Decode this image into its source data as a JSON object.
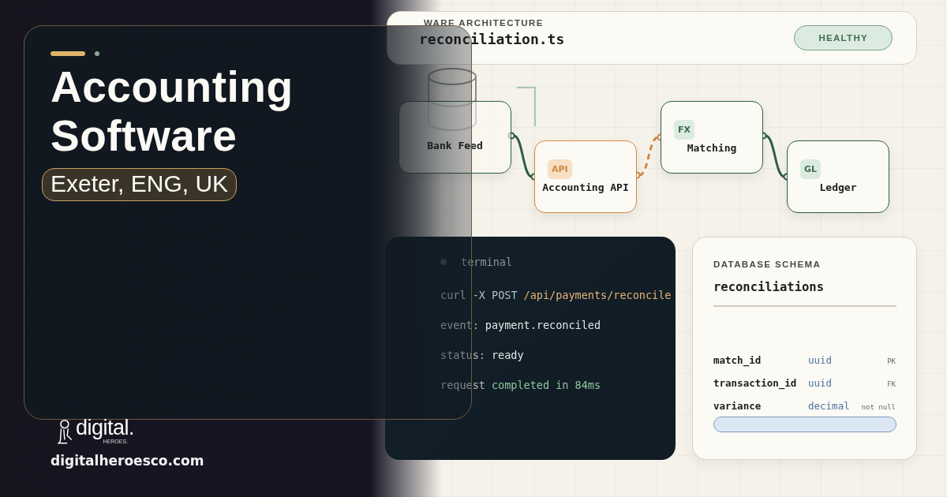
{
  "hero": {
    "title": "Accounting Software",
    "location": "Exeter, ENG, UK"
  },
  "brand": {
    "logo_text": "digital.",
    "logo_subtext": "HEROES.",
    "website": "digitalheroesco.com"
  },
  "architecture": {
    "eyebrow": "WARE ARCHITECTURE",
    "file": "reconciliation.ts",
    "status": "HEALTHY",
    "nodes": [
      {
        "kind": "database",
        "label": "Bank Feed"
      },
      {
        "kind": "accent",
        "badge": "API",
        "label": "Accounting API"
      },
      {
        "kind": "plain",
        "badge": "FX",
        "label": "Matching"
      },
      {
        "kind": "plain",
        "badge": "GL",
        "label": "Ledger"
      }
    ]
  },
  "terminal": {
    "title": "terminal",
    "lines": [
      {
        "kind": "command",
        "prefix": "curl -X POST",
        "text": "/api/payments/reconcile"
      },
      {
        "kind": "output",
        "prefix": "event:",
        "text": "payment.reconciled"
      },
      {
        "kind": "output",
        "prefix": "status:",
        "text": "ready"
      },
      {
        "kind": "success",
        "prefix": "request",
        "text": "completed in 84ms"
      }
    ]
  },
  "schema": {
    "eyebrow": "DATABASE SCHEMA",
    "table": "reconciliations",
    "columns": [
      {
        "name": "match_id",
        "type": "uuid",
        "constraint": "PK"
      },
      {
        "name": "transaction_id",
        "type": "uuid",
        "constraint": "FK"
      },
      {
        "name": "variance",
        "type": "decimal",
        "constraint": "not null"
      }
    ]
  }
}
